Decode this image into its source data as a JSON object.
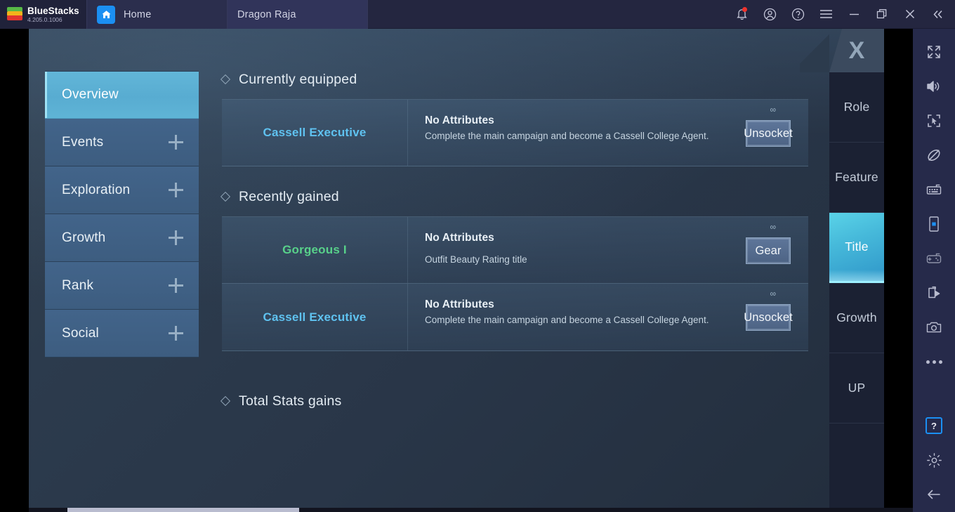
{
  "app": {
    "brand_name": "BlueStacks",
    "version": "4.205.0.1006"
  },
  "tabs": [
    {
      "label": "Home",
      "icon": "home-icon",
      "active": false
    },
    {
      "label": "Dragon Raja",
      "icon": "game-thumbnail",
      "active": true
    }
  ],
  "system_icons": [
    {
      "name": "notification-bell-icon",
      "badge": true
    },
    {
      "name": "account-icon"
    },
    {
      "name": "help-circle-icon"
    },
    {
      "name": "menu-hamburger-icon"
    },
    {
      "name": "minimize-icon"
    },
    {
      "name": "restore-icon"
    },
    {
      "name": "close-icon"
    },
    {
      "name": "collapse-chevrons-icon"
    }
  ],
  "bluestacks_tools": [
    {
      "name": "fullscreen-icon"
    },
    {
      "name": "volume-icon"
    },
    {
      "name": "cursor-capture-icon"
    },
    {
      "name": "rotate-lock-icon"
    },
    {
      "name": "keyboard-controls-icon"
    },
    {
      "name": "device-orientation-icon"
    },
    {
      "name": "gamepad-icon"
    },
    {
      "name": "media-manager-icon"
    },
    {
      "name": "screenshot-camera-icon"
    },
    {
      "name": "more-options-icon"
    },
    {
      "name": "help-icon"
    },
    {
      "name": "settings-gear-icon"
    },
    {
      "name": "back-arrow-icon"
    }
  ],
  "game": {
    "close_label": "X",
    "left_nav": [
      {
        "label": "Overview",
        "active": true,
        "expandable": false
      },
      {
        "label": "Events",
        "active": false,
        "expandable": true
      },
      {
        "label": "Exploration",
        "active": false,
        "expandable": true
      },
      {
        "label": "Growth",
        "active": false,
        "expandable": true
      },
      {
        "label": "Rank",
        "active": false,
        "expandable": true
      },
      {
        "label": "Social",
        "active": false,
        "expandable": true
      }
    ],
    "right_rail": [
      {
        "label": "Role",
        "active": false
      },
      {
        "label": "Feature",
        "active": false
      },
      {
        "label": "Title",
        "active": true
      },
      {
        "label": "Growth",
        "active": false
      },
      {
        "label": "UP",
        "active": false
      }
    ],
    "sections": {
      "currently_equipped": {
        "heading": "Currently equipped",
        "items": [
          {
            "title": "Cassell Executive",
            "title_color": "blue",
            "attr_title": "No Attributes",
            "attr_desc": "Complete the main campaign and become a Cassell College Agent.",
            "duration": "∞",
            "button": "Unsocket"
          }
        ]
      },
      "recently_gained": {
        "heading": "Recently gained",
        "items": [
          {
            "title": "Gorgeous I",
            "title_color": "green",
            "attr_title": "No Attributes",
            "attr_desc": "Outfit Beauty Rating title",
            "duration": "∞",
            "button": "Gear"
          },
          {
            "title": "Cassell Executive",
            "title_color": "blue",
            "attr_title": "No Attributes",
            "attr_desc": "Complete the main campaign and become a Cassell College Agent.",
            "duration": "∞",
            "button": "Unsocket"
          }
        ]
      },
      "total_stats": {
        "heading": "Total Stats gains"
      }
    }
  },
  "colors": {
    "accent_cyan": "#58acd1",
    "title_blue": "#5fc2f0",
    "title_green": "#58d18a",
    "topbar_bg": "#242640",
    "help_highlight": "#1b8ff2"
  }
}
